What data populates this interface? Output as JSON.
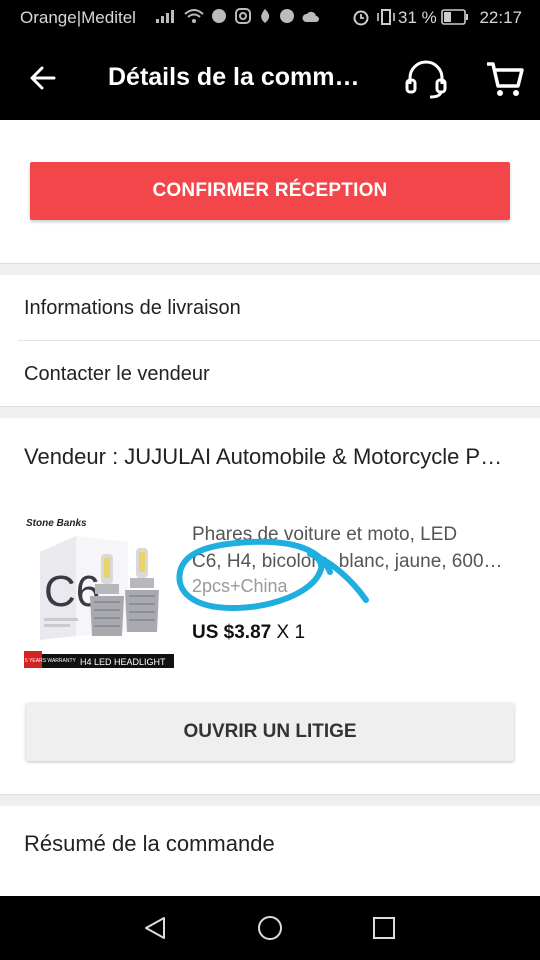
{
  "status_bar": {
    "carrier": "Orange|Meditel",
    "battery_text": "31 %",
    "time": "22:17"
  },
  "app_bar": {
    "title": "Détails de la comm…",
    "icons": [
      "back-arrow-icon",
      "headset-support-icon",
      "shopping-cart-icon"
    ]
  },
  "actions": {
    "confirm_label": "CONFIRMER RÉCEPTION",
    "dispute_label": "OUVRIR UN LITIGE"
  },
  "menu": {
    "delivery_info": "Informations de livraison",
    "contact_seller": "Contacter le vendeur"
  },
  "order": {
    "seller": "Vendeur : JUJULAI Automobile & Motorcycle P…",
    "product": {
      "title_line1": "Phares de voiture et moto, LED",
      "title_line2": "C6, H4, bicolore, blanc, jaune, 600…",
      "variant": "2pcs+China",
      "price": "US $3.87",
      "quantity": "X 1",
      "image_text": {
        "brand": "Stone Banks",
        "model": "C6",
        "warranty": "5 YEARS WARRANTY",
        "footer": "H4  LED HEADLIGHT"
      }
    }
  },
  "summary": {
    "label": "Résumé de la commande"
  },
  "colors": {
    "accent": "#f2464b",
    "annotation": "#1eaee0"
  }
}
